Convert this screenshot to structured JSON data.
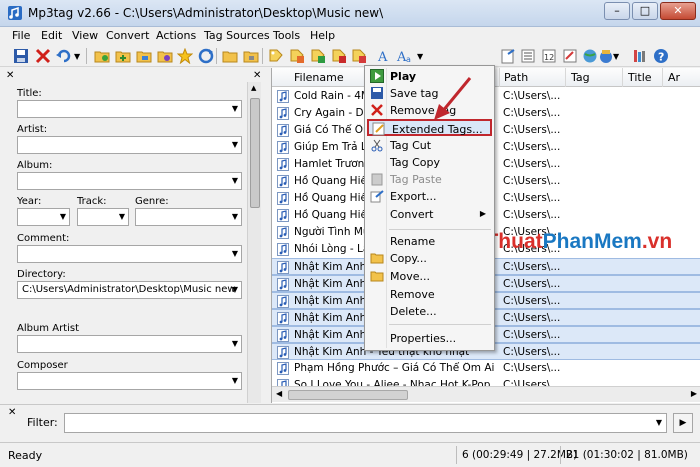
{
  "window": {
    "title": "Mp3tag v2.66  -  C:\\Users\\Administrator\\Desktop\\Music new\\",
    "minimize": "–",
    "maximize": "□",
    "close": "✕"
  },
  "menubar": [
    "File",
    "Edit",
    "View",
    "Convert",
    "Actions",
    "Tag Sources",
    "Tools",
    "Help"
  ],
  "toolbar_icons": [
    "save-icon",
    "remove-icon",
    "undo-icon",
    "dropdown-icon",
    "open-folder-icon",
    "add-folder-icon",
    "playlist-icon",
    "favorite-icon",
    "refresh-icon",
    "copy-icon",
    "lock-icon",
    "tag-icon",
    "filename-icon",
    "rename-icon",
    "convert-icon",
    "actions-icon",
    "text-icon",
    "export-icon",
    "web-icon",
    "wrench-icon",
    "help-icon"
  ],
  "tagpanel": {
    "title_label": "Title:",
    "artist_label": "Artist:",
    "album_label": "Album:",
    "year_label": "Year:",
    "track_label": "Track:",
    "genre_label": "Genre:",
    "comment_label": "Comment:",
    "directory_label": "Directory:",
    "directory_value": "C:\\Users\\Administrator\\Desktop\\Music new",
    "album_artist_label": "Album Artist",
    "composer_label": "Composer"
  },
  "columns": [
    "Filename",
    "Path",
    "Tag",
    "Title",
    "Ar"
  ],
  "files": [
    {
      "name": "Cold Rain - 4MEN",
      "path": "C:\\Users\\...",
      "selected": false
    },
    {
      "name": "Cry Again - Davichi",
      "path": "C:\\Users\\...",
      "selected": false
    },
    {
      "name": "Giá Có Thể Ôm Ai",
      "path": "C:\\Users\\...",
      "selected": false
    },
    {
      "name": "Giúp Em Trả Lời",
      "path": "C:\\Users\\...",
      "selected": false
    },
    {
      "name": "Hamlet Trương",
      "path": "C:\\Users\\...",
      "selected": false
    },
    {
      "name": "Hồ Quang Hiếu",
      "path": "C:\\Users\\...",
      "selected": false
    },
    {
      "name": "Hồ Quang Hiếu",
      "path": "C:\\Users\\...",
      "selected": false
    },
    {
      "name": "Hồ Quang Hiếu",
      "path": "C:\\Users\\...",
      "selected": false
    },
    {
      "name": "Người Tình Mùa",
      "path": "C:\\Users\\...",
      "selected": false
    },
    {
      "name": "Nhói Lòng - Lâm",
      "path": "C:\\Users\\...",
      "selected": false
    },
    {
      "name": "Nhật Kim Anh -",
      "path": "C:\\Users\\...",
      "selected": true
    },
    {
      "name": "Nhật Kim Anh -",
      "path": "C:\\Users\\...",
      "selected": true
    },
    {
      "name": "Nhật Kim Anh -",
      "path": "C:\\Users\\...",
      "selected": true
    },
    {
      "name": "Nhật Kim Anh -",
      "path": "C:\\Users\\...",
      "selected": true
    },
    {
      "name": "Nhật Kim Anh -",
      "path": "C:\\Users\\...",
      "selected": true
    },
    {
      "name": "Nhật Kim Anh - Yêu thật khó nhạt",
      "path": "C:\\Users\\...",
      "selected": true
    },
    {
      "name": "Phạm Hồng Phước – Giá Có Thể Ôm Ai ...",
      "path": "C:\\Users\\...",
      "selected": false
    },
    {
      "name": "So I Love You - Aliee - Nhạc Hot K-Pop ...",
      "path": "C:\\Users\\...",
      "selected": false
    }
  ],
  "context_menu": [
    {
      "label": "Play",
      "icon": "play-icon",
      "bold": true
    },
    {
      "label": "Save tag",
      "icon": "save-icon"
    },
    {
      "label": "Remove tag",
      "icon": "remove-icon"
    },
    {
      "label": "Extended Tags...",
      "icon": "extended-tags-icon",
      "highlighted": true
    },
    {
      "label": "Tag Cut",
      "icon": "cut-icon"
    },
    {
      "label": "Tag Copy",
      "icon": "copy-icon"
    },
    {
      "label": "Tag Paste",
      "icon": "paste-icon",
      "disabled": true
    },
    {
      "label": "Export...",
      "icon": "export-icon"
    },
    {
      "label": "Convert",
      "icon": "",
      "submenu": true
    },
    {
      "label": "Rename",
      "icon": ""
    },
    {
      "label": "Copy...",
      "icon": "copy-folder-icon"
    },
    {
      "label": "Move...",
      "icon": "move-folder-icon"
    },
    {
      "label": "Remove",
      "icon": ""
    },
    {
      "label": "Delete...",
      "icon": ""
    },
    {
      "label": "Properties...",
      "icon": ""
    }
  ],
  "watermark": {
    "part1": "ThuThuat",
    "part2": "PhanMem",
    "part3": ".vn"
  },
  "filter": {
    "label": "Filter:",
    "value": ""
  },
  "status": {
    "ready": "Ready",
    "selected": "6 (00:29:49 | 27.2MB)",
    "total": "21 (01:30:02 | 81.0MB)"
  },
  "colors": {
    "accent": "#c0272d",
    "selection": "#dce8f8",
    "watermark_red": "#d9302b",
    "watermark_blue": "#1a78c2"
  }
}
